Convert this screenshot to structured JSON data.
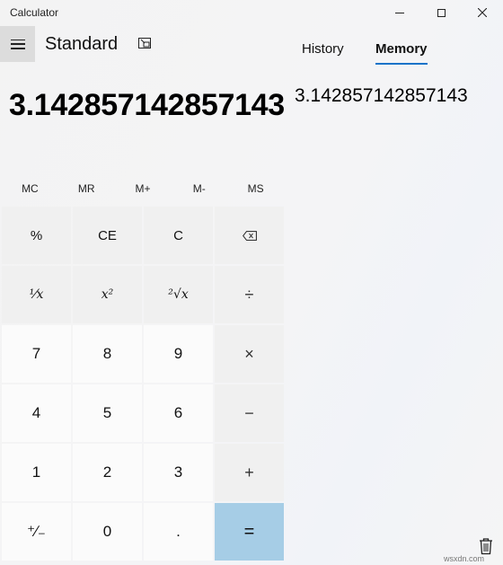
{
  "window": {
    "title": "Calculator",
    "controls": [
      "minimize",
      "maximize",
      "close"
    ]
  },
  "header": {
    "mode": "Standard",
    "menu_icon": "hamburger-icon",
    "keep_on_top_icon": "keep-on-top-icon"
  },
  "display": {
    "value": "3.142857142857143"
  },
  "memory_row": [
    "MC",
    "MR",
    "M+",
    "M-",
    "MS"
  ],
  "keys": {
    "percent": "%",
    "ce": "CE",
    "clear": "C",
    "backspace_icon": "backspace-icon",
    "reciprocal": "¹⁄x",
    "square": "x²",
    "sqrt": "²√x",
    "divide": "÷",
    "seven": "7",
    "eight": "8",
    "nine": "9",
    "multiply": "×",
    "four": "4",
    "five": "5",
    "six": "6",
    "minus": "−",
    "one": "1",
    "two": "2",
    "three": "3",
    "plus": "+",
    "negate": "⁺∕₋",
    "zero": "0",
    "decimal": ".",
    "equals": "="
  },
  "panel": {
    "tabs": [
      {
        "label": "History",
        "active": false
      },
      {
        "label": "Memory",
        "active": true
      }
    ],
    "memory_items": [
      "3.142857142857143"
    ],
    "clear_icon": "trash-icon"
  },
  "watermark": "wsxdn.com",
  "colors": {
    "equals_key": "#a6cde6",
    "accent_underline": "#1a73c9",
    "number_key": "#fbfbfb",
    "function_key": "#f0f0f0"
  }
}
